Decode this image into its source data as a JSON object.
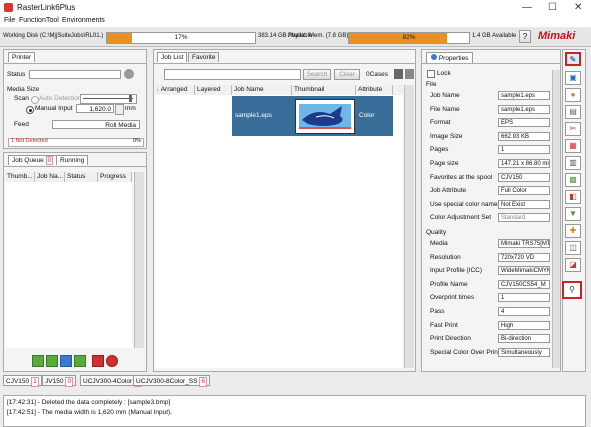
{
  "app": {
    "title": "RasterLink6Plus",
    "menu": [
      "File",
      "Function",
      "Tool",
      "Environments"
    ],
    "window_controls": [
      "—",
      "☐",
      "✕"
    ]
  },
  "status": {
    "working_disk_label": "Working Disk (C:\\MjjSuiteJobs\\RL01.)",
    "disk_percent": "17%",
    "disk_fill": 0.17,
    "disk_available": "383.14 GB Available",
    "phys_mem_label": "Physic. Mem. (7.8 GB)",
    "mem_percent": "82%",
    "mem_fill": 0.82,
    "mem_available": "1.4 GB Available",
    "help": "?",
    "brand": "Mimaki"
  },
  "printer": {
    "tab": "Printer",
    "status_label": "Status",
    "media_size_label": "Media Size",
    "scan_label": "Scan",
    "auto_detection": "Auto Detection",
    "manual_input": "Manual Input",
    "manual_value": "1,620.0",
    "unit": "mm",
    "feed_label": "Feed",
    "feed_value": "Roll Media",
    "ink_status": "1 Not Detected",
    "ink_percent": "0%"
  },
  "queue": {
    "tab_queue": "Job Queue",
    "queue_count": "0",
    "tab_running": "Running",
    "columns": [
      "Thumb...",
      "Job Na...",
      "Status",
      "Progress"
    ]
  },
  "joblist": {
    "tab_joblist": "Job List",
    "tab_favorite": "Favorite",
    "search_btn": "Search",
    "clear_btn": "Clear",
    "cases": "0Cases",
    "columns": [
      "Arranged",
      "Layered",
      "Job Name",
      "Thumbnail",
      "Attribute"
    ],
    "rows": [
      {
        "job_name": "sample1.eps",
        "attribute": "Color"
      }
    ]
  },
  "properties": {
    "tab": "Properties",
    "lock": "Lock",
    "file_section": "File",
    "file_rows": [
      {
        "k": "Job Name",
        "v": "sample1.eps"
      },
      {
        "k": "File Name",
        "v": "sample1.eps"
      },
      {
        "k": "Format",
        "v": "EPS"
      },
      {
        "k": "Image Size",
        "v": "662.93 KB"
      },
      {
        "k": "Pages",
        "v": "1"
      },
      {
        "k": "Page size",
        "v": "147.21 x 86.80 mm"
      },
      {
        "k": "Favorites at the spool",
        "v": "CJV150"
      },
      {
        "k": "Job Attribute",
        "v": "Full Color"
      },
      {
        "k": "Use special color names",
        "v": "Not Exist"
      },
      {
        "k": "Color Adjustment Set",
        "v": "Standard"
      }
    ],
    "quality_section": "Quality",
    "quality_rows": [
      {
        "k": "Media",
        "v": "Mimaki TRS75[MTV"
      },
      {
        "k": "Resolution",
        "v": "720x720 VD"
      },
      {
        "k": "Input Profile (ICC)",
        "v": "WideMimakiCMYK.ic"
      },
      {
        "k": "Profile Name",
        "v": "CJV150CS54_M"
      },
      {
        "k": "Overprint times",
        "v": "1"
      },
      {
        "k": "Pass",
        "v": "4"
      },
      {
        "k": "Fast Print",
        "v": "High"
      },
      {
        "k": "Print Direction",
        "v": "Bi-direction"
      },
      {
        "k": "Special Color Over Print",
        "v": "Simultaneously"
      }
    ]
  },
  "printers": [
    {
      "name": "CJV150",
      "count": "1"
    },
    {
      "name": "JV150",
      "count": "0"
    },
    {
      "name": "UCJV300-4Color",
      "count": "0"
    },
    {
      "name": "UCJV300-8Color_SS",
      "count": "6"
    }
  ],
  "log": [
    "[17:42:31] - Deleted the data completely : [sample3.bmp]",
    "[17:42:51] - The media width is 1,620 mm (Manual Input)."
  ]
}
